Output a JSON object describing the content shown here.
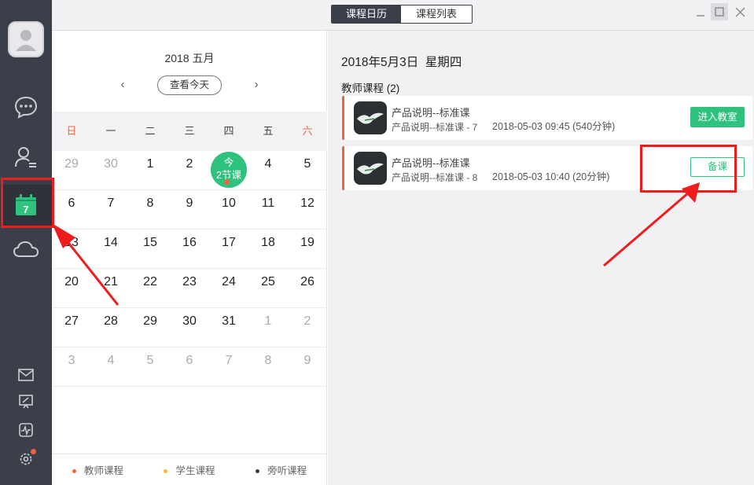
{
  "tabs": {
    "calendar": "课程日历",
    "list": "课程列表"
  },
  "sidebar": {
    "calendar_day": "7",
    "items": [
      "chat-icon",
      "contacts-icon",
      "calendar-icon",
      "cloud-icon",
      "mail-icon",
      "presentation-icon",
      "activity-icon",
      "settings-icon"
    ]
  },
  "calendar": {
    "title": "2018 五月",
    "today_button": "查看今天",
    "prev": "‹",
    "next": "›",
    "weekdays": [
      "日",
      "一",
      "二",
      "三",
      "四",
      "五",
      "六"
    ],
    "weeks": [
      [
        "29",
        "30",
        "1",
        "2",
        "今",
        "4",
        "5"
      ],
      [
        "6",
        "7",
        "8",
        "9",
        "10",
        "11",
        "12"
      ],
      [
        "13",
        "14",
        "15",
        "16",
        "17",
        "18",
        "19"
      ],
      [
        "20",
        "21",
        "22",
        "23",
        "24",
        "25",
        "26"
      ],
      [
        "27",
        "28",
        "29",
        "30",
        "31",
        "1",
        "2"
      ],
      [
        "3",
        "4",
        "5",
        "6",
        "7",
        "8",
        "9"
      ]
    ],
    "today_label": "今",
    "today_count": "2节课",
    "legend": [
      {
        "label": "教师课程",
        "color": "#f0643c"
      },
      {
        "label": "学生课程",
        "color": "#f5b82e"
      },
      {
        "label": "旁听课程",
        "color": "#3b3f4a"
      }
    ]
  },
  "detail": {
    "date": "2018年5月3日  星期四",
    "section": "教师课程 (2)",
    "courses": [
      {
        "title": "产品说明--标准课",
        "subtitle": "产品说明--标准课 - 7",
        "time": "2018-05-03 09:45 (540分钟)",
        "action": "进入教室"
      },
      {
        "title": "产品说明--标准课",
        "subtitle": "产品说明--标准课 - 8",
        "time": "2018-05-03 10:40 (20分钟)",
        "action": "备课"
      }
    ]
  },
  "colors": {
    "accent": "#2ec27e",
    "teacher": "#f0643c",
    "sidebar": "#3b3f4a",
    "annotation": "#ee1c1c"
  }
}
